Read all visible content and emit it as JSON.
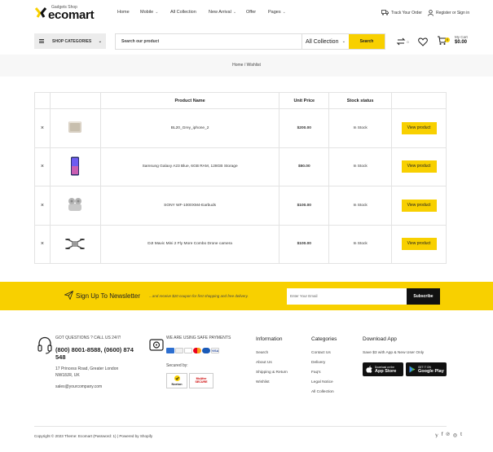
{
  "brand": {
    "tagline": "Gadgets Shop",
    "name": "ecomart"
  },
  "nav": [
    {
      "label": "Home",
      "dropdown": false
    },
    {
      "label": "Mobile",
      "dropdown": true
    },
    {
      "label": "All Collection",
      "dropdown": false
    },
    {
      "label": "New Arrival",
      "dropdown": true
    },
    {
      "label": "Offer",
      "dropdown": false
    },
    {
      "label": "Pages",
      "dropdown": true
    }
  ],
  "header_right": {
    "track_order": "Track Your Order",
    "account": "Register or Sign in"
  },
  "categories_button": "SHOP CATEGORIES",
  "search": {
    "placeholder": "Search our product",
    "collection": "All Collection",
    "button": "Search"
  },
  "compare_count": "0",
  "cart": {
    "count": "0",
    "label": "My Cart",
    "amount": "$0.00"
  },
  "breadcrumb": {
    "home": "Home",
    "separator": "/",
    "current": "Wishlist"
  },
  "table": {
    "headers": [
      "",
      "",
      "Product Name",
      "Unit Price",
      "Stock status",
      ""
    ],
    "remove_symbol": "×",
    "rows": [
      {
        "name": "BL20_Grey_iphone_2",
        "price": "$200.00",
        "stock": "In Stock",
        "action": "View product",
        "image": "device-icon"
      },
      {
        "name": "Samsung Galaxy A23 Blue, 6GB RAM, 128GB Storage",
        "price": "$50.00",
        "stock": "In Stock",
        "action": "View product",
        "image": "phone-icon"
      },
      {
        "name": "SONY WF-1000XM4-Earbuds",
        "price": "$100.00",
        "stock": "In Stock",
        "action": "View product",
        "image": "earbuds-icon"
      },
      {
        "name": "DJI Mavic Mini 2 Fly More Combo Drone camera",
        "price": "$100.00",
        "stock": "In Stock",
        "action": "View product",
        "image": "drone-icon"
      }
    ]
  },
  "newsletter": {
    "title": "Sign Up To Newsletter",
    "subtitle": "...and receive $20 coupon for first shopping and free delivery.",
    "placeholder": "Enter Your Email",
    "button": "Subscribe"
  },
  "footer": {
    "contact": {
      "question": "GOT QUESTIONS ? CALL US 24/7!",
      "phone": "(800) 8001-8588, (0600) 874 548",
      "address1": "17 Princess Road, Greater London",
      "address2": "NW18JR, UK",
      "email": "sales@yourcompany.com"
    },
    "payments": {
      "title": "WE ARE USING SAFE PAYMENTS",
      "secured_by": "Secured by:",
      "norton": "Norton",
      "mcafee": "McAfee SECURE"
    },
    "information": {
      "title": "Information",
      "links": [
        "Search",
        "About Us",
        "Shipping & Return",
        "Wishlist"
      ]
    },
    "categories": {
      "title": "Categories",
      "links": [
        "Contact Us",
        "Delivery",
        "Faq's",
        "Legal Notice",
        "All Collection"
      ]
    },
    "app": {
      "title": "Download App",
      "subtitle": "Save $3 with App & New User Only",
      "appstore_small": "Download on the",
      "appstore_big": "App Store",
      "play_small": "GET IT ON",
      "play_big": "Google Play"
    },
    "copyright": "Copyright © 2023 Theme: Ecomart (Password: 1) | Powered by Shopify"
  },
  "colors": {
    "accent": "#f8d000",
    "stock": "#3bb24a",
    "dark": "#111111"
  }
}
